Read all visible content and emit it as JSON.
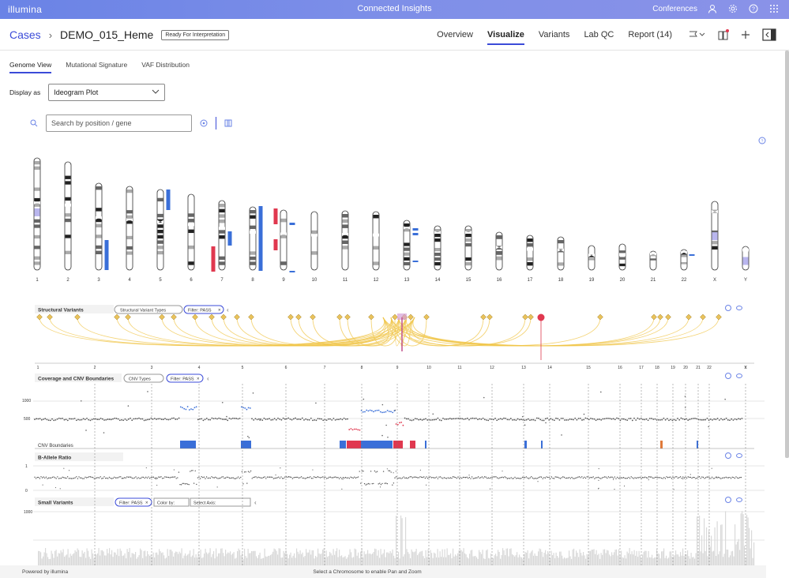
{
  "topbar": {
    "logo": "illumina",
    "app_title": "Connected Insights",
    "workgroup": "Conferences"
  },
  "header": {
    "cases_link": "Cases",
    "case_name": "DEMO_015_Heme",
    "status_badge": "Ready For Interpretation"
  },
  "nav": {
    "tabs": [
      "Overview",
      "Visualize",
      "Variants",
      "Lab QC",
      "Report (14)"
    ],
    "active": "Visualize"
  },
  "subtabs": {
    "items": [
      "Genome View",
      "Mutational Signature",
      "VAF Distribution"
    ],
    "active": "Genome View"
  },
  "display": {
    "label": "Display as",
    "value": "Ideogram Plot"
  },
  "search": {
    "placeholder": "Search by position / gene"
  },
  "chromosomes": [
    "1",
    "2",
    "3",
    "4",
    "5",
    "6",
    "7",
    "8",
    "9",
    "10",
    "11",
    "12",
    "13",
    "14",
    "15",
    "16",
    "17",
    "18",
    "19",
    "20",
    "21",
    "22",
    "X",
    "Y"
  ],
  "tracks": {
    "sv": {
      "title": "Structural Variants",
      "chip1": "Structural Variant Types",
      "chip2": "Filter: PASS"
    },
    "cnv": {
      "title": "Coverage and CNV Boundaries",
      "chip1": "CNV Types",
      "chip2": "Filter: PASS",
      "y1000": "1000",
      "y500": "500",
      "boundaries_label": "CNV Boundaries"
    },
    "baf": {
      "title": "B-Allele Ratio",
      "y1": "1",
      "y0": "0"
    },
    "small": {
      "title": "Small Variants",
      "chip1": "Filter: PASS",
      "colorby": "Color by:",
      "axis": "Select Axis:",
      "y1000": "1000"
    }
  },
  "colors": {
    "accent": "#3b4bd8",
    "gain": "#3a6fd8",
    "loss": "#e0384f",
    "sv": "#f0c64a"
  },
  "footer": {
    "powered": "Powered by illumina",
    "hint": "Select a Chromosome to enable Pan and Zoom"
  }
}
